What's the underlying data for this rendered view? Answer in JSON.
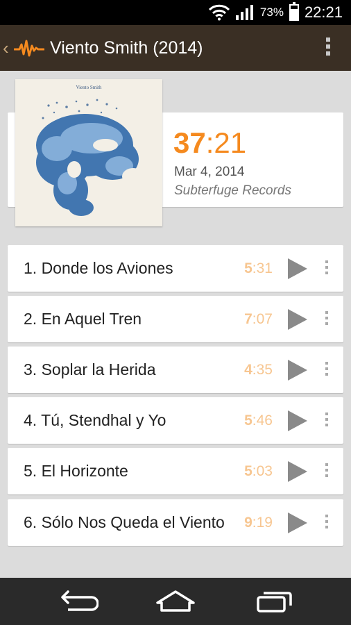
{
  "status_bar": {
    "battery_percent": "73%",
    "battery_level": 0.73,
    "time": "22:21",
    "icons": [
      "wifi-icon",
      "signal-icon",
      "battery-icon"
    ]
  },
  "action_bar": {
    "back_icon": "chevron-left-icon",
    "logo_icon": "waveform-logo-icon",
    "title": "Viento Smith (2014)",
    "menu_icon": "overflow-menu-icon"
  },
  "album": {
    "cover_title": "Viento Smith",
    "duration_minutes": "37",
    "duration_separator": ":",
    "duration_seconds": "21",
    "release_date": "Mar 4, 2014",
    "label": "Subterfuge Records"
  },
  "tracks": [
    {
      "title": "1. Donde los Aviones",
      "minutes": "5",
      "seconds": ":31"
    },
    {
      "title": "2. En Aquel Tren",
      "minutes": "7",
      "seconds": ":07"
    },
    {
      "title": "3. Soplar la Herida",
      "minutes": "4",
      "seconds": ":35"
    },
    {
      "title": "4. Tú, Stendhal y Yo",
      "minutes": "5",
      "seconds": ":46"
    },
    {
      "title": "5. El Horizonte",
      "minutes": "5",
      "seconds": ":03"
    },
    {
      "title": "6. Sólo Nos Queda el Viento",
      "minutes": "9",
      "seconds": ":19"
    }
  ],
  "colors": {
    "accent": "#f58a1f",
    "track_time": "#f7c691",
    "action_bar": "#3a2f24",
    "background": "#dcdcdc"
  },
  "nav_bar": {
    "icons": [
      "back-icon",
      "home-icon",
      "recent-apps-icon"
    ]
  }
}
